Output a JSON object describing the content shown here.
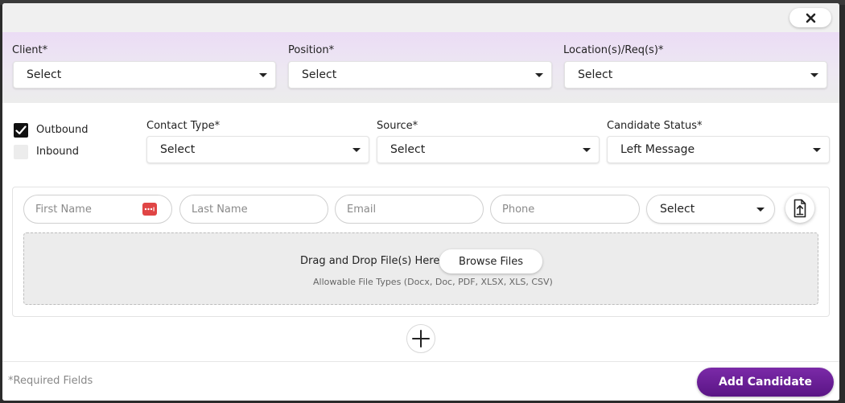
{
  "modal": {
    "close_icon": "close-icon"
  },
  "top_row": {
    "client": {
      "label": "Client*",
      "value": "Select"
    },
    "position": {
      "label": "Position*",
      "value": "Select"
    },
    "location": {
      "label": "Location(s)/Req(s)*",
      "value": "Select"
    }
  },
  "direction": {
    "outbound": {
      "label": "Outbound",
      "checked": true
    },
    "inbound": {
      "label": "Inbound",
      "checked": false
    }
  },
  "second_row": {
    "contact_type": {
      "label": "Contact Type*",
      "value": "Select"
    },
    "source": {
      "label": "Source*",
      "value": "Select"
    },
    "candidate_status": {
      "label": "Candidate Status*",
      "value": "Left Message"
    }
  },
  "candidate": {
    "first_name_placeholder": "First Name",
    "last_name_placeholder": "Last Name",
    "email_placeholder": "Email",
    "phone_placeholder": "Phone",
    "type_select": "Select",
    "password_icon": "password-manager-icon",
    "upload_icon": "file-upload-icon"
  },
  "dropzone": {
    "text": "Drag and Drop File(s) Here or",
    "browse_label": "Browse Files",
    "allowed": "Allowable File Types (Docx, Doc, PDF, XLSX, XLS, CSV)"
  },
  "add_row_icon": "plus-icon",
  "footer": {
    "required_note": "*Required Fields",
    "submit_label": "Add Candidate"
  },
  "colors": {
    "accent": "#6a1d96",
    "band": "#ebdcf5",
    "badge_red": "#e04545"
  }
}
